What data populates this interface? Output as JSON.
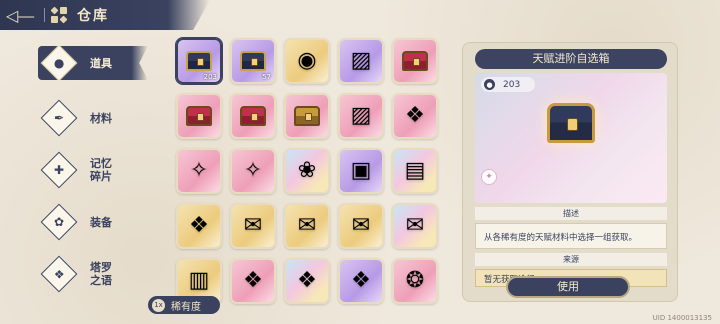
{
  "header": {
    "title": "仓库",
    "back_icon": "back-arrow-icon",
    "grid_icon": "warehouse-grid-icon"
  },
  "sidebar": {
    "items": [
      {
        "label": "道具",
        "icon": "item-pouch-icon",
        "active": true
      },
      {
        "label": "材料",
        "icon": "feather-quill-icon",
        "active": false
      },
      {
        "label": "记忆\n碎片",
        "icon": "puzzle-piece-icon",
        "active": false
      },
      {
        "label": "装备",
        "icon": "equipment-bird-icon",
        "active": false
      },
      {
        "label": "塔罗\n之语",
        "icon": "tarot-compass-icon",
        "active": false
      }
    ]
  },
  "grid": {
    "items": [
      {
        "kind": "chest-navy",
        "rarity": "purple",
        "qty": "203",
        "selected": true
      },
      {
        "kind": "chest-navy",
        "rarity": "purple",
        "qty": "57"
      },
      {
        "kind": "orb",
        "rarity": "gold",
        "qty": ""
      },
      {
        "kind": "card",
        "rarity": "purple",
        "qty": ""
      },
      {
        "kind": "chest-red",
        "rarity": "pink",
        "qty": ""
      },
      {
        "kind": "chest-red",
        "rarity": "pink",
        "qty": ""
      },
      {
        "kind": "chest-red",
        "rarity": "pink",
        "qty": ""
      },
      {
        "kind": "chest-gold",
        "rarity": "pink",
        "qty": ""
      },
      {
        "kind": "card",
        "rarity": "pink",
        "qty": ""
      },
      {
        "kind": "crystal",
        "rarity": "pink",
        "qty": ""
      },
      {
        "kind": "wand",
        "rarity": "pink",
        "qty": ""
      },
      {
        "kind": "wand",
        "rarity": "pink",
        "qty": ""
      },
      {
        "kind": "flowers",
        "rarity": "rainbow",
        "qty": ""
      },
      {
        "kind": "box",
        "rarity": "purple",
        "qty": ""
      },
      {
        "kind": "book",
        "rarity": "rainbow",
        "qty": ""
      },
      {
        "kind": "crystal",
        "rarity": "gold",
        "qty": ""
      },
      {
        "kind": "letter",
        "rarity": "gold",
        "qty": ""
      },
      {
        "kind": "letter",
        "rarity": "gold",
        "qty": ""
      },
      {
        "kind": "letter",
        "rarity": "gold",
        "qty": ""
      },
      {
        "kind": "letter",
        "rarity": "rainbow",
        "qty": ""
      },
      {
        "kind": "tome",
        "rarity": "gold",
        "qty": ""
      },
      {
        "kind": "crystal",
        "rarity": "pink",
        "qty": ""
      },
      {
        "kind": "crystal",
        "rarity": "rainbow",
        "qty": ""
      },
      {
        "kind": "crystal",
        "rarity": "purple",
        "qty": ""
      },
      {
        "kind": "lantern",
        "rarity": "pink",
        "qty": ""
      }
    ]
  },
  "rarity_filter": {
    "badge": "1x",
    "label": "稀有度"
  },
  "detail": {
    "title": "天赋进阶自选箱",
    "count": "203",
    "description_header": "描述",
    "description": "从各稀有度的天赋材料中选择一组获取。",
    "source_header": "来源",
    "source": "暂无获取途径",
    "use_button": "使用"
  },
  "uid": "UID 1400013135",
  "colors": {
    "accent": "#3a425f",
    "panel": "#e4dccb",
    "gold": "#c69b3f"
  }
}
